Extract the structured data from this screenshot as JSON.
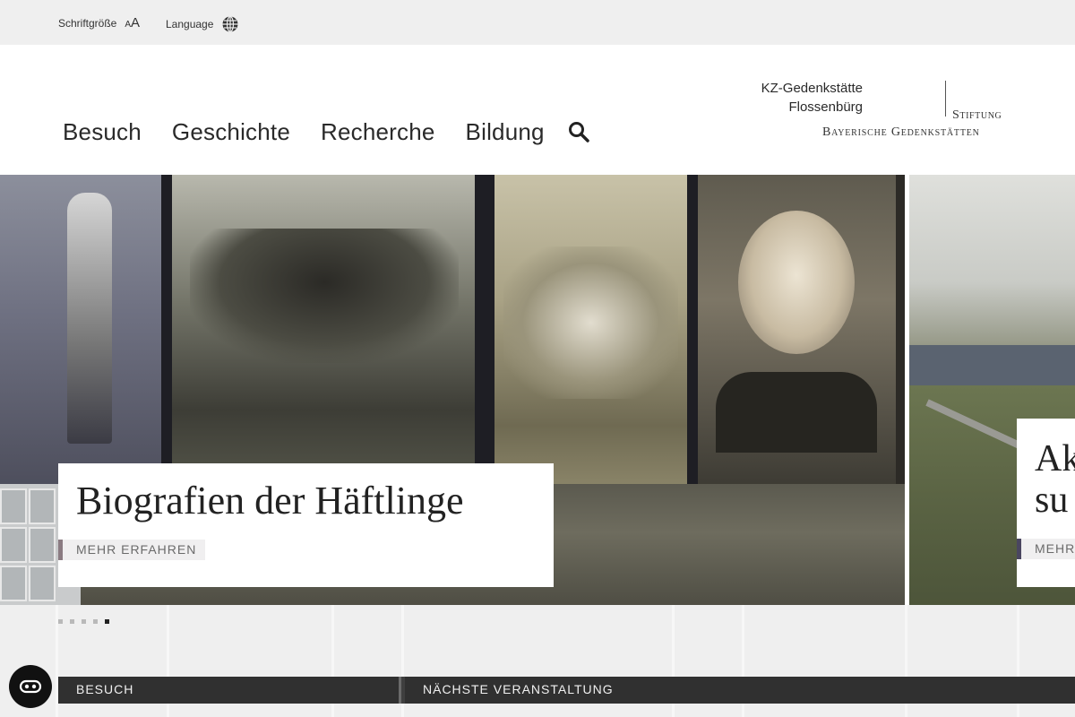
{
  "utility": {
    "font_size_label": "Schriftgröße",
    "font_size_small": "A",
    "font_size_big": "A",
    "language_label": "Language"
  },
  "nav": {
    "items": [
      "Besuch",
      "Geschichte",
      "Recherche",
      "Bildung"
    ]
  },
  "logo": {
    "line1": "KZ-Gedenkstätte",
    "line2": "Flossenbürg",
    "stiftung": "Stiftung",
    "bayerische": "Bayerische Gedenkstätten"
  },
  "hero": {
    "active_title": "Biografien der Häftlinge",
    "active_cta": "MEHR ERFAHREN",
    "next_title": "Ak su",
    "next_cta": "MEHR"
  },
  "slider": {
    "dot_count": 5,
    "active_dot": 5
  },
  "bars": {
    "besuch": "BESUCH",
    "event": "NÄCHSTE VERANSTALTUNG"
  },
  "colors": {
    "accent_rose": "#8b7b82",
    "accent_violet": "#4a4660",
    "bar_dark": "#303030",
    "utility_bg": "#efefef"
  },
  "icons": {
    "language": "globe-icon",
    "search": "search-icon",
    "accessibility": "accessibility-icon"
  }
}
